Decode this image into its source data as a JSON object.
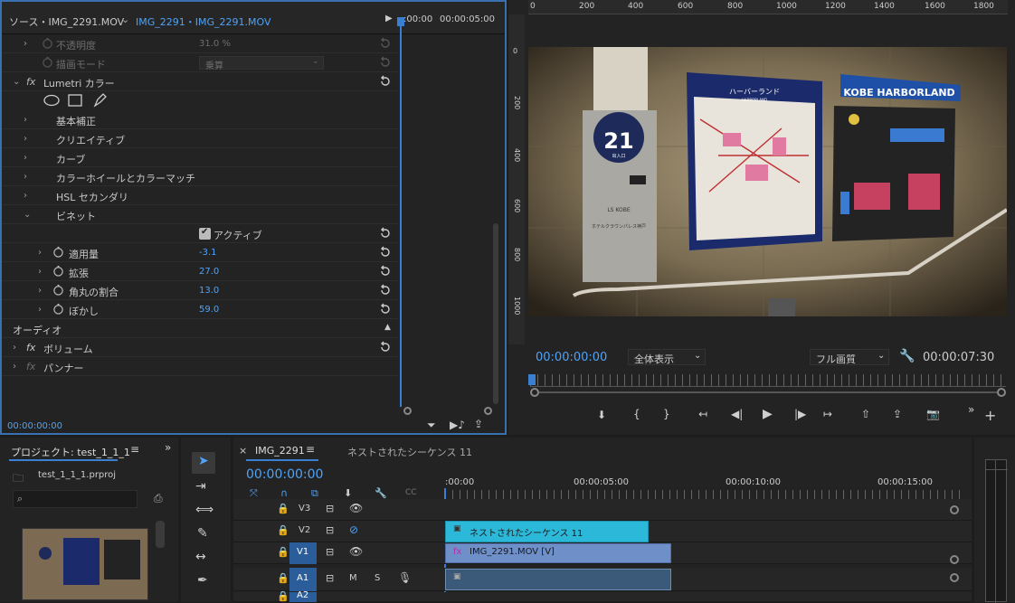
{
  "effect_controls": {
    "source_tab": "ソース・IMG_2291.MOV",
    "clip_tab": "IMG_2291・IMG_2291.MOV",
    "ruler_start": ":00:00",
    "ruler_mark": "00:00:05:00",
    "rows": [
      {
        "label": "不透明度",
        "value": "31.0 %"
      },
      {
        "label": "描画モード",
        "value": "乗算"
      },
      {
        "label": "Lumetri カラー"
      },
      {
        "label": "基本補正"
      },
      {
        "label": "クリエイティブ"
      },
      {
        "label": "カーブ"
      },
      {
        "label": "カラーホイールとカラーマッチ"
      },
      {
        "label": "HSL セカンダリ"
      },
      {
        "label": "ビネット"
      },
      {
        "label": "アクティブ"
      },
      {
        "label": "適用量",
        "value": "-3.1"
      },
      {
        "label": "拡張",
        "value": "27.0"
      },
      {
        "label": "角丸の割合",
        "value": "13.0"
      },
      {
        "label": "ぼかし",
        "value": "59.0"
      },
      {
        "label": "オーディオ"
      },
      {
        "label": "ボリューム"
      },
      {
        "label": "パンナー"
      }
    ],
    "timecode": "00:00:00:00",
    "fx_symbol": "fx"
  },
  "program": {
    "ruler_ticks": [
      "0",
      "200",
      "400",
      "600",
      "800",
      "1000",
      "1200",
      "1400",
      "1600",
      "1800"
    ],
    "vruler_ticks": [
      "0",
      "200",
      "400",
      "600",
      "800",
      "1000"
    ],
    "timecode": "00:00:00:00",
    "zoom": "全体表示",
    "quality": "フル画質",
    "duration": "00:00:07:30",
    "sign_number": "21",
    "sign_exit": "出入口",
    "map_title": "ハーバーランド",
    "map_sub": "HARBORLAND",
    "kobe_title": "KOBE HARBORLAND",
    "sign_logo": "LS KOBE",
    "sign_small": "ホテルクラウンパレス神戸"
  },
  "project": {
    "title": "プロジェクト: test_1_1_1",
    "file": "test_1_1_1.prproj"
  },
  "timeline": {
    "tab": "IMG_2291",
    "tab2": "ネストされたシーケンス 11",
    "timecode": "00:00:00:00",
    "ruler": [
      ":00:00",
      "00:00:05:00",
      "00:00:10:00",
      "00:00:15:00"
    ],
    "tracks": [
      "V3",
      "V2",
      "V1",
      "A1",
      "A2"
    ],
    "clip_nested": "ネストされたシーケンス 11",
    "clip_v1": "IMG_2291.MOV [V]",
    "mute": "M",
    "solo": "S"
  },
  "colors": {
    "accent": "#4fa3f7",
    "clip_cyan": "#2bb8d9",
    "clip_v1": "#6f8fc8",
    "clip_audio": "#3b5a7a",
    "yellow": "#e6d62b"
  }
}
